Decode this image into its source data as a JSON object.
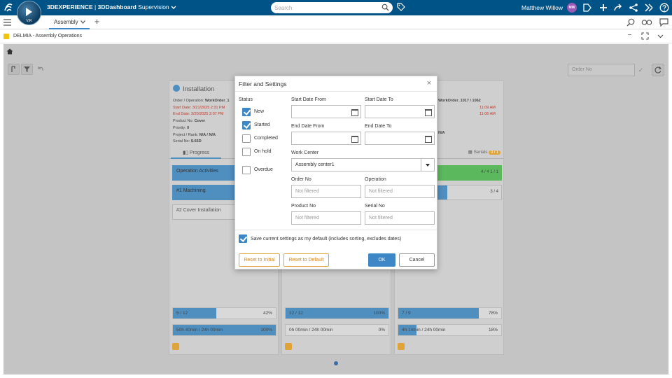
{
  "topbar": {
    "logo_icon": "3ds-logo-icon",
    "compass_version": "V,R",
    "brand_prefix": "3DEXPERIENCE",
    "brand_app": "3DDashboard",
    "brand_context": "Supervision",
    "search_placeholder": "Search",
    "user_name": "Matthew Willow",
    "avatar_initials": "MW"
  },
  "tabbar": {
    "tab_label": "Assembly"
  },
  "widget": {
    "title": "DELMIA - Assembly Operations"
  },
  "toolbar": {
    "order_placeholder": "Order No"
  },
  "cards": [
    {
      "title": "Installation",
      "order_label": "Order / Operation:",
      "order_value": "WorkOrder_1",
      "start": "Start Date: 3/21/2025 2:31 PM",
      "end": "End Date: 3/20/2025 2:07 PM",
      "product": "Product No: ",
      "product_value": "Cover",
      "priority": "Priority: ",
      "priority_value": "0",
      "project": "Project / Rank: ",
      "project_value": "N/A / N/A",
      "serial": "Serial No: ",
      "serial_value": "$-65D",
      "tab": "Progress",
      "rows": [
        "Operation Activities",
        "#1 Machining",
        "#2 Cover Installation"
      ],
      "bar1": {
        "label": "5 / 12",
        "pct": "42%",
        "value": 0.42
      },
      "bar2": {
        "label": "50h 40min / 24h 00min",
        "pct": "100%",
        "value": 1.0
      }
    },
    {
      "bar1": {
        "label": "12 / 12",
        "pct": "100%",
        "value": 1.0
      },
      "bar2": {
        "label": "0h 00min / 24h 00min",
        "pct": "0%",
        "value": 0.0
      }
    },
    {
      "order_value": "WorkOrder_1017 / 1062",
      "start_time": "11:09 AM",
      "end_time": "11:06 AM",
      "project_value": "N/A",
      "serials_label": "Serials",
      "serials_count": "0 / 1",
      "row1_right": "4 / 4   1 / 1",
      "row2_right": "3 / 4",
      "bar1": {
        "label": "7 / 9",
        "pct": "78%",
        "value": 0.78
      },
      "bar2": {
        "label": "4h 14min / 24h 00min",
        "pct": "18%",
        "value": 0.18
      }
    }
  ],
  "dialog": {
    "title": "Filter and Settings",
    "status_label": "Status",
    "statuses": [
      {
        "label": "New",
        "checked": true
      },
      {
        "label": "Started",
        "checked": true
      },
      {
        "label": "Completed",
        "checked": false
      },
      {
        "label": "On hold",
        "checked": false
      },
      {
        "label": "Overdue",
        "checked": false
      }
    ],
    "start_from": "Start Date From",
    "start_to": "Start Date To",
    "end_from": "End Date From",
    "end_to": "End Date To",
    "work_center_label": "Work Center",
    "work_center_value": "Assembly center1",
    "order_no": "Order No",
    "operation": "Operation",
    "product_no": "Product No",
    "serial_no": "Serial No",
    "not_filtered": "Not filtered",
    "save_default": "Save current settings as my default (includes sorting, excludes dates)",
    "reset_initial": "Reset to Initial",
    "reset_default": "Reset to Default",
    "ok": "OK",
    "cancel": "Cancel"
  }
}
